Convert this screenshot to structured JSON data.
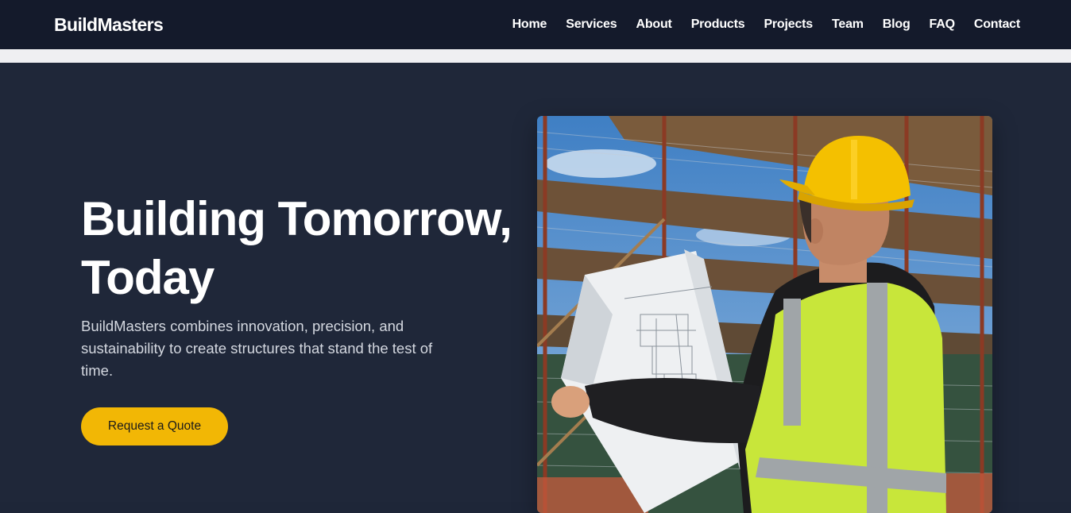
{
  "header": {
    "brand": "BuildMasters",
    "nav": [
      {
        "label": "Home"
      },
      {
        "label": "Services"
      },
      {
        "label": "About"
      },
      {
        "label": "Products"
      },
      {
        "label": "Projects"
      },
      {
        "label": "Team"
      },
      {
        "label": "Blog"
      },
      {
        "label": "FAQ"
      },
      {
        "label": "Contact"
      }
    ]
  },
  "hero": {
    "headline_line1": "Building Tomorrow,",
    "headline_line2": "Today",
    "subtext": "BuildMasters combines innovation, precision, and sustainability to create structures that stand the test of time.",
    "cta_label": "Request a Quote",
    "image_icon": "construction-worker-blueprint-photo"
  },
  "colors": {
    "header_bg": "#141a2b",
    "hero_bg": "#1f2739",
    "accent": "#f2b705",
    "text_primary": "#ffffff",
    "text_muted": "#d4d8e0"
  }
}
